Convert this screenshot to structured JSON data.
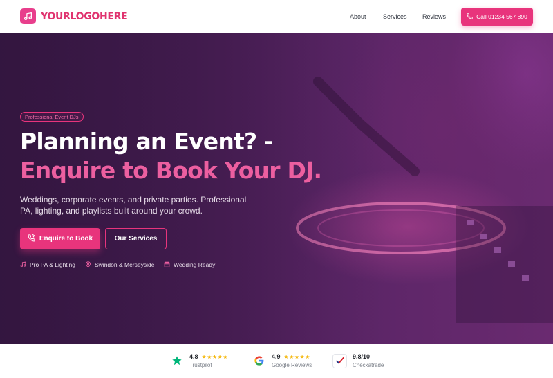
{
  "header": {
    "logo_text": "YOURLOGOHERE",
    "logo_icon": "music-note-icon",
    "nav": {
      "about": "About",
      "services": "Services",
      "reviews": "Reviews"
    },
    "call_label": "Call 01234 567 890",
    "call_icon": "phone-icon"
  },
  "hero": {
    "badge": "Professional Event DJs",
    "headline_part1": "Planning an Event? - ",
    "headline_accent": "Enquire to Book Your DJ.",
    "subtext": "Weddings, corporate events, and private parties. Professional PA, lighting, and playlists built around your crowd.",
    "primary_button": "Enquire to Book",
    "primary_icon": "phone-call-icon",
    "secondary_button": "Our Services",
    "features": [
      {
        "label": "Pro PA & Lighting",
        "icon": "music-note-icon"
      },
      {
        "label": "Swindon & Merseyside",
        "icon": "map-pin-icon"
      },
      {
        "label": "Wedding Ready",
        "icon": "calendar-icon"
      }
    ]
  },
  "reviews": [
    {
      "score": "4.8",
      "stars": "★★★★★",
      "source": "Trustpilot",
      "icon": "trustpilot-star-icon"
    },
    {
      "score": "4.9",
      "stars": "★★★★★",
      "source": "Google Reviews",
      "icon": "google-g-icon"
    },
    {
      "score": "9.8/10",
      "source": "Checkatrade",
      "icon": "checkatrade-tick-icon"
    }
  ],
  "colors": {
    "accent": "#e8347c",
    "accent_text": "#ec5fa0",
    "hero_dark": "#3b1a4a",
    "star": "#f4b400",
    "trustpilot": "#00b67a"
  }
}
